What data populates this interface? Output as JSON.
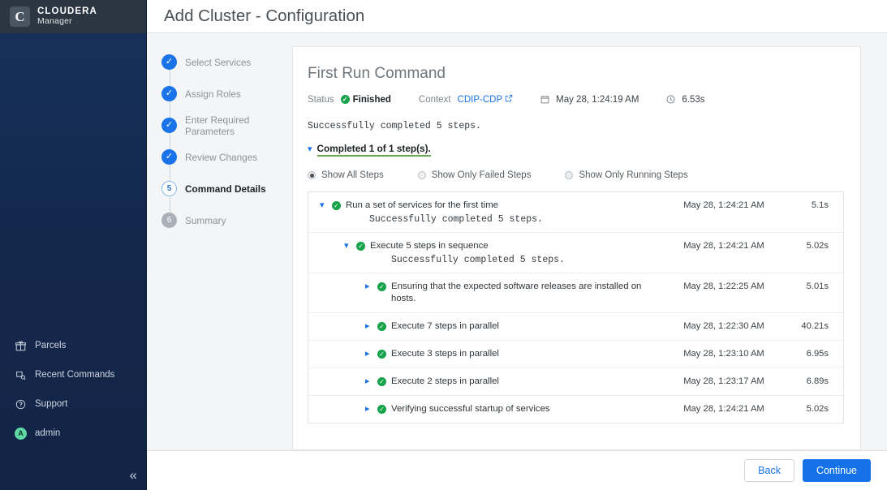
{
  "brand": {
    "logo_letter": "C",
    "name_top": "CLOUDERA",
    "name_bottom": "Manager"
  },
  "sidebar": {
    "items": [
      {
        "label": "Parcels",
        "icon": "gift-icon"
      },
      {
        "label": "Recent Commands",
        "icon": "commands-icon"
      },
      {
        "label": "Support",
        "icon": "question-circle-icon"
      },
      {
        "label": "admin",
        "icon": "avatar-icon",
        "avatar_letter": "A"
      }
    ],
    "collapse_label": "«"
  },
  "header": {
    "title": "Add Cluster - Configuration"
  },
  "wizard": {
    "steps": [
      {
        "label": "Select Services",
        "state": "done",
        "marker": "✓"
      },
      {
        "label": "Assign Roles",
        "state": "done",
        "marker": "✓"
      },
      {
        "label": "Enter Required Parameters",
        "state": "done",
        "marker": "✓"
      },
      {
        "label": "Review Changes",
        "state": "done",
        "marker": "✓"
      },
      {
        "label": "Command Details",
        "state": "current",
        "marker": "5"
      },
      {
        "label": "Summary",
        "state": "pending",
        "marker": "6"
      }
    ]
  },
  "command": {
    "title": "First Run Command",
    "status_key": "Status",
    "status_value": "Finished",
    "context_key": "Context",
    "context_value": "CDIP-CDP",
    "date": "May 28, 1:24:19 AM",
    "duration": "6.53s",
    "summary": "Successfully completed 5 steps.",
    "completed_toggle": "Completed 1 of 1 step(s).",
    "filters": [
      {
        "label": "Show All Steps",
        "selected": true
      },
      {
        "label": "Show Only Failed Steps",
        "selected": false
      },
      {
        "label": "Show Only Running Steps",
        "selected": false
      }
    ],
    "steps": [
      {
        "label": "Run a set of services for the first time",
        "sub": "Successfully completed 5 steps.",
        "time": "May 28, 1:24:21 AM",
        "duration": "5.1s",
        "indent": 0,
        "expanded": true
      },
      {
        "label": "Execute 5 steps in sequence",
        "sub": "Successfully completed 5 steps.",
        "time": "May 28, 1:24:21 AM",
        "duration": "5.02s",
        "indent": 1,
        "expanded": true
      },
      {
        "label": "Ensuring that the expected software releases are installed on hosts.",
        "sub": "",
        "time": "May 28, 1:22:25 AM",
        "duration": "5.01s",
        "indent": 2,
        "expanded": false
      },
      {
        "label": "Execute 7 steps in parallel",
        "sub": "",
        "time": "May 28, 1:22:30 AM",
        "duration": "40.21s",
        "indent": 2,
        "expanded": false
      },
      {
        "label": "Execute 3 steps in parallel",
        "sub": "",
        "time": "May 28, 1:23:10 AM",
        "duration": "6.95s",
        "indent": 2,
        "expanded": false
      },
      {
        "label": "Execute 2 steps in parallel",
        "sub": "",
        "time": "May 28, 1:23:17 AM",
        "duration": "6.89s",
        "indent": 2,
        "expanded": false
      },
      {
        "label": "Verifying successful startup of services",
        "sub": "",
        "time": "May 28, 1:24:21 AM",
        "duration": "5.02s",
        "indent": 2,
        "expanded": false
      }
    ]
  },
  "footer": {
    "back_label": "Back",
    "continue_label": "Continue"
  },
  "colors": {
    "accent_blue": "#1a73e8",
    "primary_button": "#1472e6",
    "success_green": "#16a34a",
    "underline_green": "#6aa84f",
    "sidebar_dark": "#16325c",
    "avatar_green": "#5fd9a6"
  }
}
